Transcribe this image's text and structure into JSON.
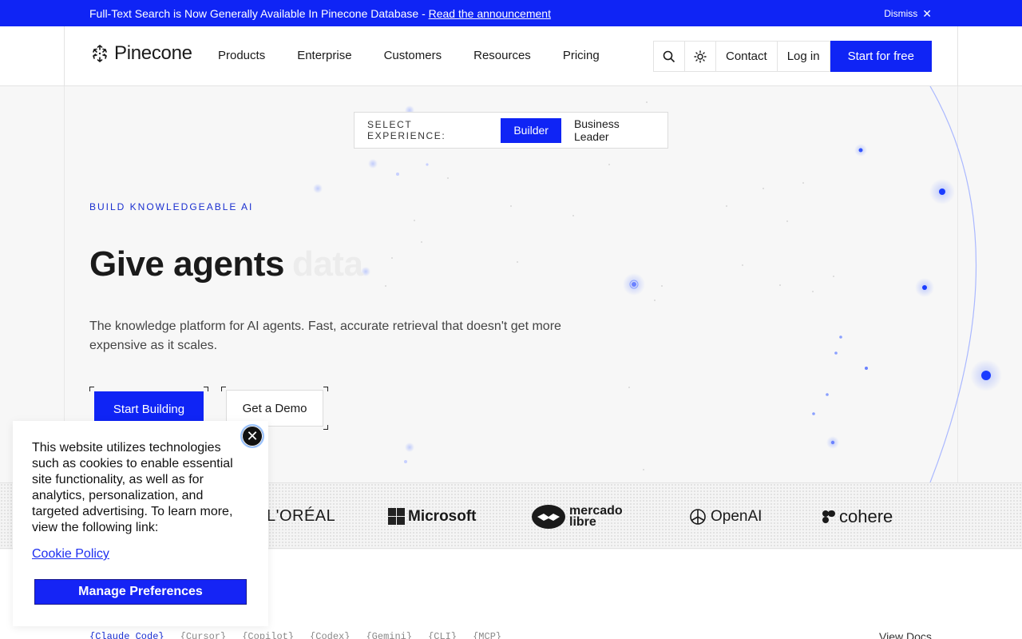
{
  "announcement": {
    "text": "Full-Text Search is Now Generally Available In Pinecone Database - ",
    "link": "Read the announcement",
    "dismiss": "Dismiss"
  },
  "header": {
    "logo": "Pinecone",
    "nav": [
      "Products",
      "Enterprise",
      "Customers",
      "Resources",
      "Pricing"
    ],
    "contact": "Contact",
    "login": "Log in",
    "cta": "Start for free"
  },
  "hero": {
    "experience_label": "SELECT EXPERIENCE:",
    "experience_options": [
      "Builder",
      "Business Leader"
    ],
    "eyebrow": "BUILD KNOWLEDGEABLE AI",
    "headline": "Give agents",
    "headline_ghost": "data",
    "subtext": "The knowledge platform for AI agents. Fast, accurate retrieval that doesn't get more expensive as it scales.",
    "primary_button": "Start Building",
    "secondary_button": "Get a Demo"
  },
  "logos": [
    "L'ORÉAL",
    "Microsoft",
    "mercado libre",
    "OpenAI",
    "cohere"
  ],
  "bottom": {
    "tags": [
      "{Claude Code}",
      "{Cursor}",
      "{Copilot}",
      "{Codex}",
      "{Gemini}",
      "{CLI}",
      "{MCP}"
    ],
    "view_docs": "View Docs"
  },
  "cookie": {
    "text": "This website utilizes technologies such as cookies to enable essential site functionality, as well as for analytics, personalization, and targeted advertising. To learn more, view the following link:",
    "link": "Cookie Policy",
    "button": "Manage Preferences"
  },
  "colors": {
    "brand_blue": "#0f24f5",
    "eyebrow_blue": "#1a2fd0"
  }
}
